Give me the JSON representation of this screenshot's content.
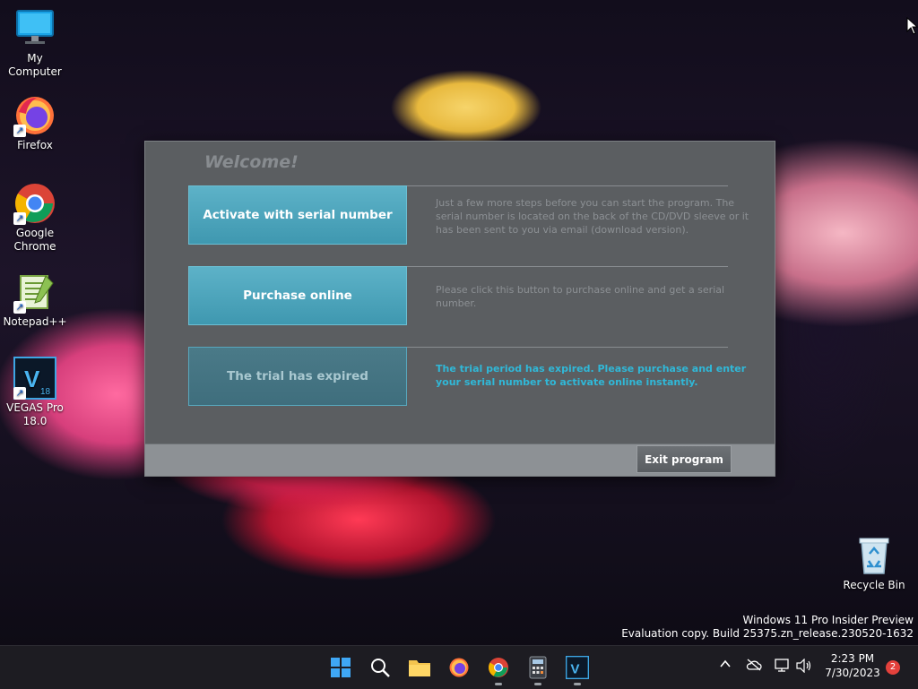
{
  "desktop": {
    "icons": [
      {
        "label": "My Computer",
        "icon": "monitor-icon"
      },
      {
        "label": "Firefox",
        "icon": "firefox-icon"
      },
      {
        "label": "Google Chrome",
        "icon": "chrome-icon"
      },
      {
        "label": "Notepad++",
        "icon": "notepadpp-icon"
      },
      {
        "label": "VEGAS Pro 18.0",
        "icon": "vegas-icon",
        "glyph": "V",
        "sub": "18"
      },
      {
        "label": "Recycle Bin",
        "icon": "recycle-bin-icon"
      }
    ]
  },
  "dialog": {
    "title": "Welcome!",
    "options": [
      {
        "button": "Activate with serial number",
        "description": "Just a few more steps before you can start the program. The serial number is located on the back of the CD/DVD sleeve or it has been sent to you via email (download version)."
      },
      {
        "button": "Purchase online",
        "description": "Please click this button to purchase online and get a serial number."
      },
      {
        "button": "The trial has expired",
        "description": "The trial period has expired. Please purchase and enter your serial number to activate online instantly."
      }
    ],
    "exit_label": "Exit program"
  },
  "watermark": {
    "line1": "Windows 11 Pro Insider Preview",
    "line2": "Evaluation copy. Build 25375.zn_release.230520-1632"
  },
  "taskbar": {
    "apps": [
      "start-icon",
      "search-icon",
      "file-explorer-icon",
      "firefox-icon",
      "chrome-icon",
      "calculator-icon",
      "vegas-icon"
    ],
    "time": "2:23 PM",
    "date": "7/30/2023",
    "notification_count": "2"
  }
}
